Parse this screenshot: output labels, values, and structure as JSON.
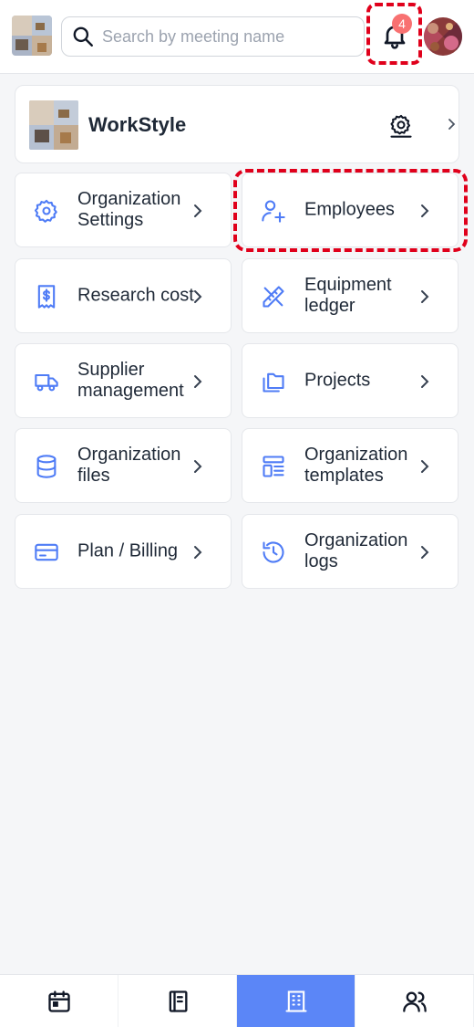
{
  "topbar": {
    "search": {
      "placeholder": "Search by meeting name",
      "value": ""
    },
    "notifications": {
      "count": "4"
    }
  },
  "organization": {
    "name": "WorkStyle"
  },
  "tiles": [
    {
      "label": "Organization Settings",
      "icon": "gear-icon"
    },
    {
      "label": "Employees",
      "icon": "user-plus-icon"
    },
    {
      "label": "Research cost",
      "icon": "receipt-dollar-icon"
    },
    {
      "label": "Equipment ledger",
      "icon": "ruler-pencil-icon"
    },
    {
      "label": "Supplier management",
      "icon": "truck-icon"
    },
    {
      "label": "Projects",
      "icon": "folders-icon"
    },
    {
      "label": "Organization files",
      "icon": "database-icon"
    },
    {
      "label": "Organization templates",
      "icon": "template-icon"
    },
    {
      "label": "Plan / Billing",
      "icon": "credit-card-icon"
    },
    {
      "label": "Organization logs",
      "icon": "history-icon"
    }
  ],
  "bottom_nav": [
    {
      "name": "calendar-icon",
      "active": false
    },
    {
      "name": "notebook-icon",
      "active": false
    },
    {
      "name": "building-icon",
      "active": true
    },
    {
      "name": "users-icon",
      "active": false
    }
  ],
  "colors": {
    "accent": "#5b86f7",
    "icon_blue": "#4f7cf6",
    "highlight": "#e0001b",
    "badge": "#f87171"
  }
}
